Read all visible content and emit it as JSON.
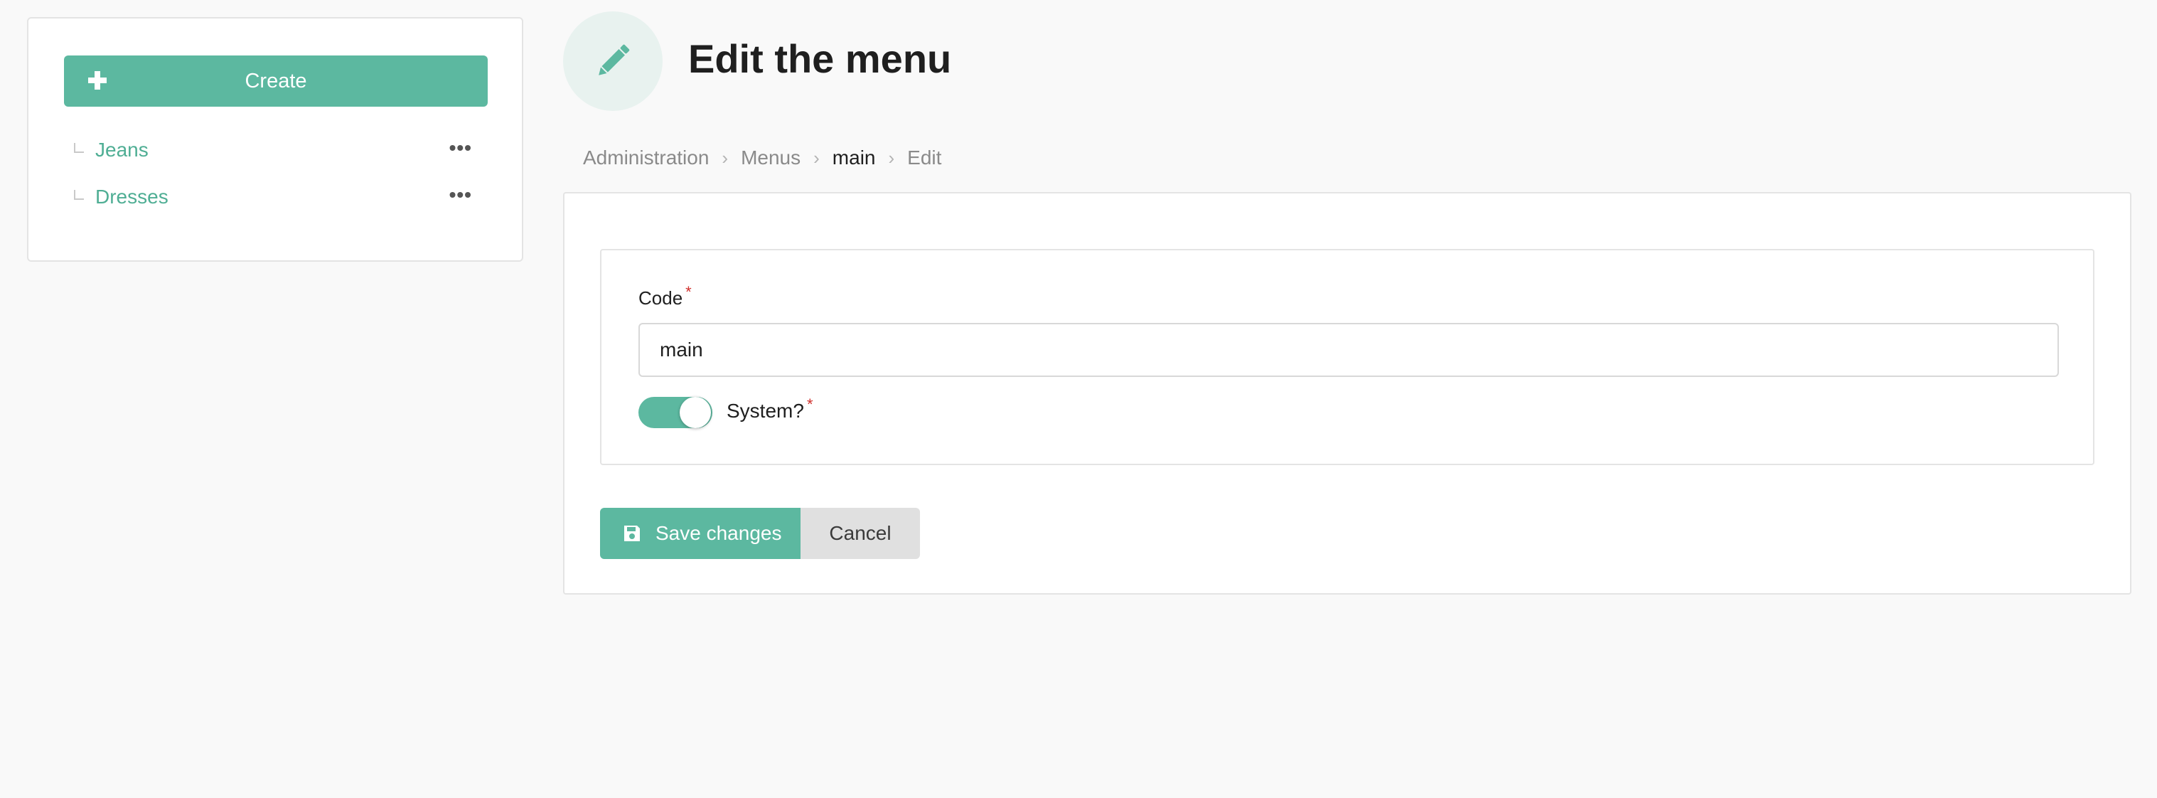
{
  "sidebar": {
    "create_label": "Create",
    "items": [
      {
        "label": "Jeans",
        "more": "•••"
      },
      {
        "label": "Dresses",
        "more": "•••"
      }
    ]
  },
  "header": {
    "title": "Edit the menu",
    "icon": "pencil-icon"
  },
  "breadcrumb": {
    "items": [
      "Administration",
      "Menus",
      "main",
      "Edit"
    ],
    "separator": "›"
  },
  "form": {
    "code_label": "Code",
    "code_value": "main",
    "required_mark": "*",
    "system_label": "System?",
    "system_enabled": true,
    "save_label": "Save changes",
    "cancel_label": "Cancel"
  },
  "colors": {
    "accent": "#5cb8a0",
    "link": "#4fae94",
    "required": "#d0312d"
  }
}
